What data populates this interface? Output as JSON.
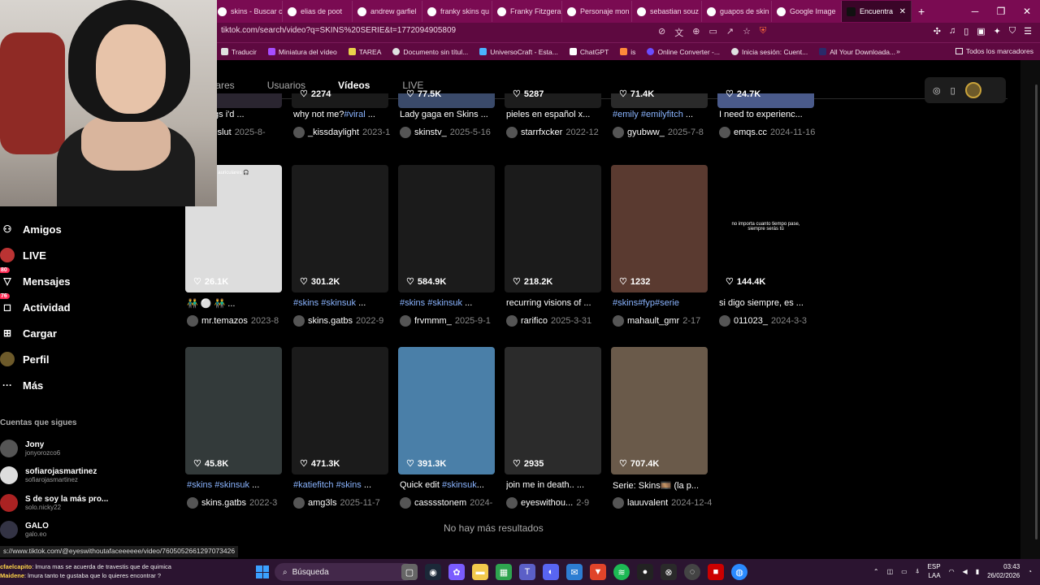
{
  "browser": {
    "tabs": [
      {
        "label": "skins - Buscar c"
      },
      {
        "label": "elias de poot"
      },
      {
        "label": "andrew garfiel"
      },
      {
        "label": "franky skins qu"
      },
      {
        "label": "Franky Fitzgera"
      },
      {
        "label": "Personaje mon"
      },
      {
        "label": "sebastian souz"
      },
      {
        "label": "guapos de skin"
      },
      {
        "label": "Google Image"
      },
      {
        "label": "Encuentra"
      }
    ],
    "new_tab": "+",
    "url": "tiktok.com/search/video?q=SKINS%20SERIE&t=1772094905809",
    "bookmarks": [
      "Traducir",
      "Miniatura del vídeo",
      "TAREA",
      "Documento sin títul...",
      "UniversoCraft - Esta...",
      "ChatGPT",
      "is",
      "Online Converter -...",
      "Inicia sesión: Cuent...",
      "All Your Downloada..."
    ],
    "bookmarks_all": "Todos los marcadores"
  },
  "search_tabs": [
    {
      "label": "ulares",
      "active": false
    },
    {
      "label": "Usuarios",
      "active": false
    },
    {
      "label": "Vídeos",
      "active": true
    },
    {
      "label": "LIVE",
      "active": false
    }
  ],
  "sidebar": {
    "items": [
      {
        "label": "Amigos",
        "icon": "friends-icon",
        "badge": ""
      },
      {
        "label": "LIVE",
        "icon": "live-icon",
        "badge": ""
      },
      {
        "label": "Mensajes",
        "icon": "messages-icon",
        "badge": "80"
      },
      {
        "label": "Actividad",
        "icon": "activity-icon",
        "badge": "76"
      },
      {
        "label": "Cargar",
        "icon": "upload-icon",
        "badge": ""
      },
      {
        "label": "Perfil",
        "icon": "profile-icon",
        "badge": ""
      },
      {
        "label": "Más",
        "icon": "more-icon",
        "badge": ""
      }
    ],
    "following_title": "Cuentas que sigues",
    "following": [
      {
        "name": "Jony",
        "handle": "jonyorozco6"
      },
      {
        "name": "sofiarojasmartinez",
        "handle": "sofiarojasmartinez"
      },
      {
        "name": "S de soy la más pro...",
        "handle": "solo.nicky22"
      },
      {
        "name": "GALO",
        "handle": "galo.eo"
      }
    ]
  },
  "videos_row1": [
    {
      "likes": "5K",
      "desc": "he things i'd ...",
      "user": "xxieslut",
      "date": "2025-8-"
    },
    {
      "likes": "2274",
      "desc": "why not me?#viral ...",
      "user": "_kissdaylight",
      "date": "2023-1"
    },
    {
      "likes": "77.5K",
      "desc": "Lady gaga en Skins ...",
      "user": "skinstv_",
      "date": "2025-5-16"
    },
    {
      "likes": "5287",
      "desc": "pieles en español x...",
      "user": "starrfxcker",
      "date": "2022-12"
    },
    {
      "likes": "71.4K",
      "desc": "#emily #emilyfitch ...",
      "user": "gyubww_",
      "date": "2025-7-8"
    },
    {
      "likes": "24.7K",
      "desc": "I need to experienc...",
      "user": "emqs.cc",
      "date": "2024-11-16"
    }
  ],
  "videos_row2": [
    {
      "likes": "26.1K",
      "desc": "👬 ⚪ 👬 ...",
      "user": "mr.temazos",
      "date": "2023-8",
      "thumb_text": "auriculares 🎧"
    },
    {
      "likes": "301.2K",
      "desc": "#skins #skinsuk ...",
      "user": "skins.gatbs",
      "date": "2022-9"
    },
    {
      "likes": "584.9K",
      "desc": "#skins #skinsuk ...",
      "user": "frvmmm_",
      "date": "2025-9-1"
    },
    {
      "likes": "218.2K",
      "desc": "recurring visions of ...",
      "user": "rarifico",
      "date": "2025-3-31"
    },
    {
      "likes": "1232",
      "desc": "#skins#fyp#serie",
      "user": "mahault_gmr",
      "date": "2-17"
    },
    {
      "likes": "144.4K",
      "desc": "si digo siempre, es ...",
      "user": "011023_",
      "date": "2024-3-3",
      "thumb_text": "no importa cuanto tiempo pase, siempre serás tú"
    }
  ],
  "videos_row3": [
    {
      "likes": "45.8K",
      "desc": "#skins #skinsuk ...",
      "user": "skins.gatbs",
      "date": "2022-3"
    },
    {
      "likes": "471.3K",
      "desc": "#katiefitch #skins ...",
      "user": "amg3ls",
      "date": "2025-11-7"
    },
    {
      "likes": "391.3K",
      "desc": "Quick edit #skinsuk...",
      "user": "casssstonem",
      "date": "2024-"
    },
    {
      "likes": "2935",
      "desc": "join me in death.. ...",
      "user": "eyeswithou...",
      "date": "2-9"
    },
    {
      "likes": "707.4K",
      "desc": "Serie: Skins🎞️ (la p...",
      "user": "lauuvalent",
      "date": "2024-12-4"
    }
  ],
  "no_more_results": "No hay más resultados",
  "status_link": "s://www.tiktok.com/@eyeswithoutafaceeeeee/video/7605052661297073426",
  "chat": [
    {
      "user": "cfaelcapito",
      "msg": ": lmura mas se acuerda de travestis que de quimica"
    },
    {
      "user": "Maidene",
      "msg": ": lmura tanto te gustaba que lo quieres encontrar ?"
    }
  ],
  "taskbar": {
    "search_placeholder": "Búsqueda",
    "lang": "ESP",
    "lang2": "LAA",
    "time": "03:43",
    "date": "26/02/2026"
  },
  "colors": {
    "tab_bar": "#7a0b52",
    "address_bar": "#5e0940",
    "tag_blue": "#8ab4ff",
    "badge_red": "#fe2c55"
  }
}
